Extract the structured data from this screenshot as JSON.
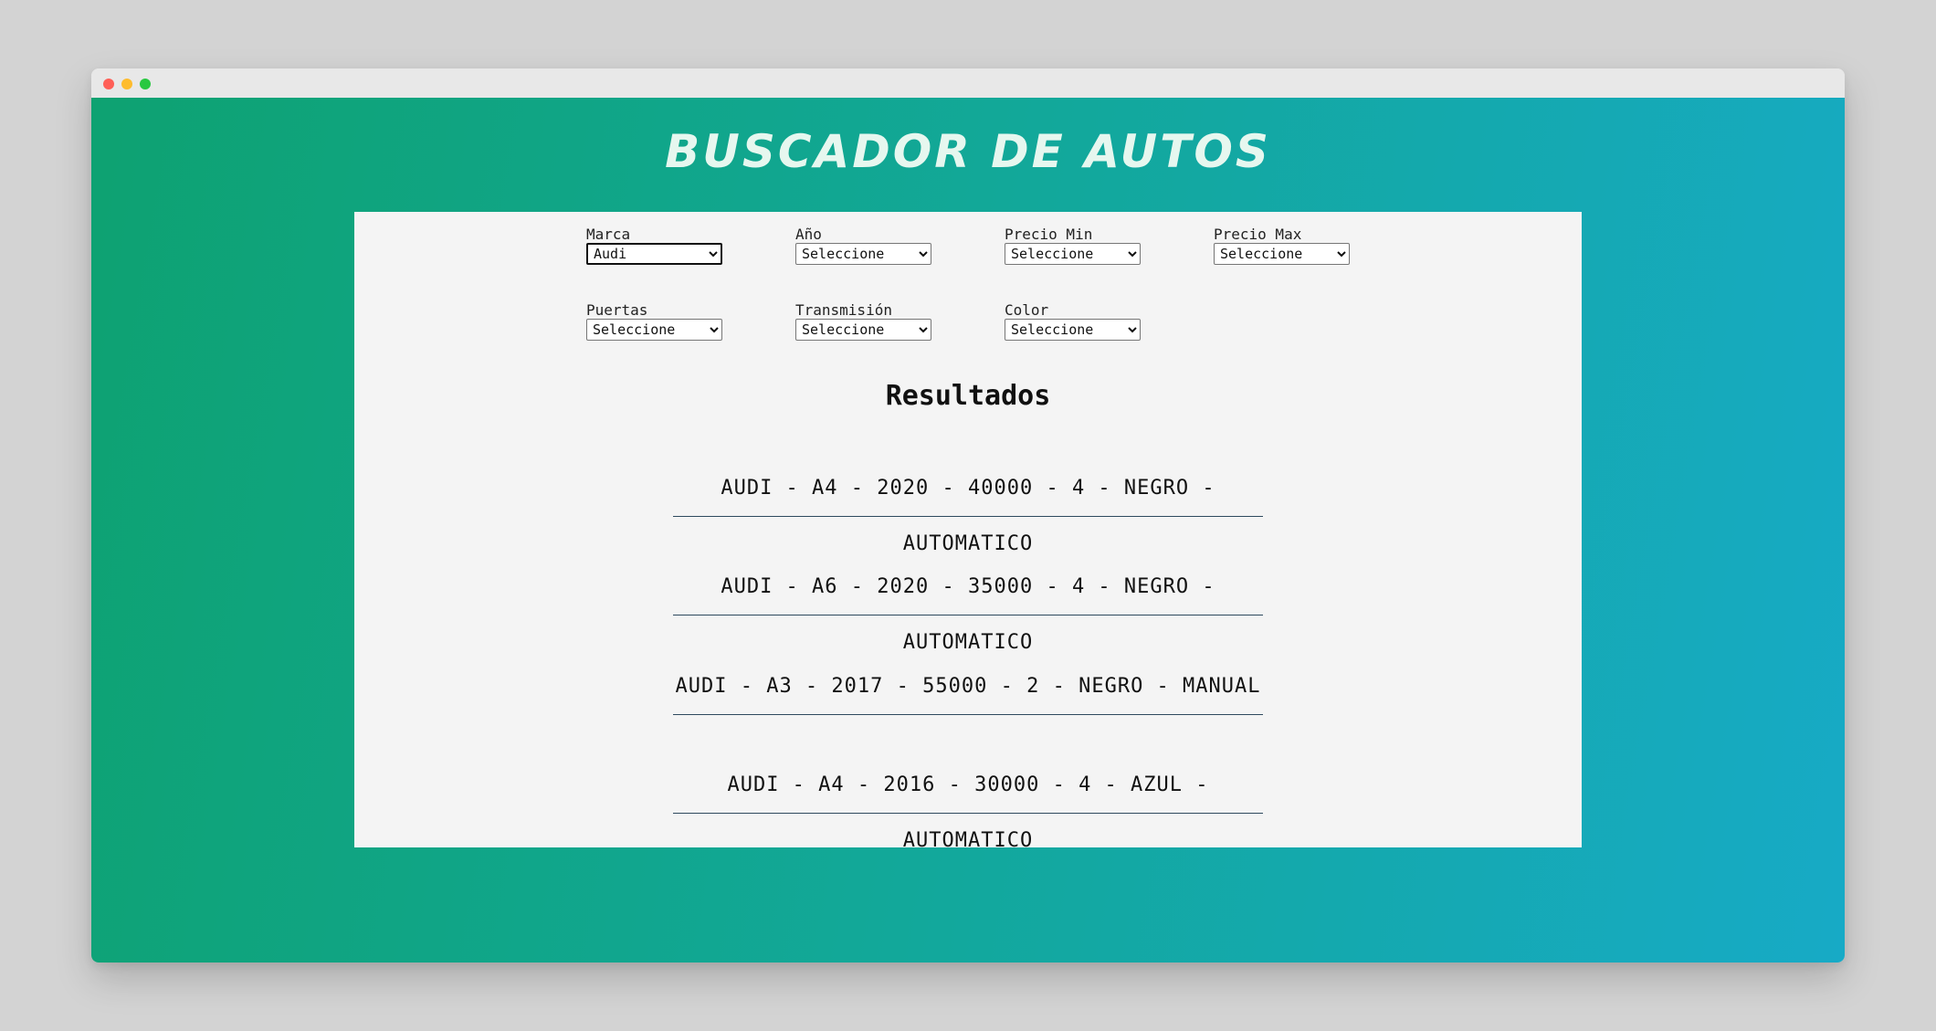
{
  "header": {
    "title": "Buscador de Autos"
  },
  "filters": [
    {
      "label": "Marca",
      "selected": "Audi"
    },
    {
      "label": "Año",
      "selected": "Seleccione"
    },
    {
      "label": "Precio Min",
      "selected": "Seleccione"
    },
    {
      "label": "Precio Max",
      "selected": "Seleccione"
    },
    {
      "label": "Puertas",
      "selected": "Seleccione"
    },
    {
      "label": "Transmisión",
      "selected": "Seleccione"
    },
    {
      "label": "Color",
      "selected": "Seleccione"
    }
  ],
  "results": {
    "title": "Resultados",
    "items": [
      "AUDI - A4 - 2020 - 40000 - 4 - NEGRO - AUTOMATICO",
      "AUDI - A6 - 2020 - 35000 - 4 - NEGRO - AUTOMATICO",
      "AUDI - A3 - 2017 - 55000 - 2 - NEGRO - MANUAL",
      "AUDI - A4 - 2016 - 30000 - 4 - AZUL - AUTOMATICO"
    ]
  },
  "colors": {
    "gradient_start": "#0ea271",
    "gradient_end": "#17aac6",
    "panel": "#f4f4f4",
    "title_text": "#e6f7ef"
  }
}
